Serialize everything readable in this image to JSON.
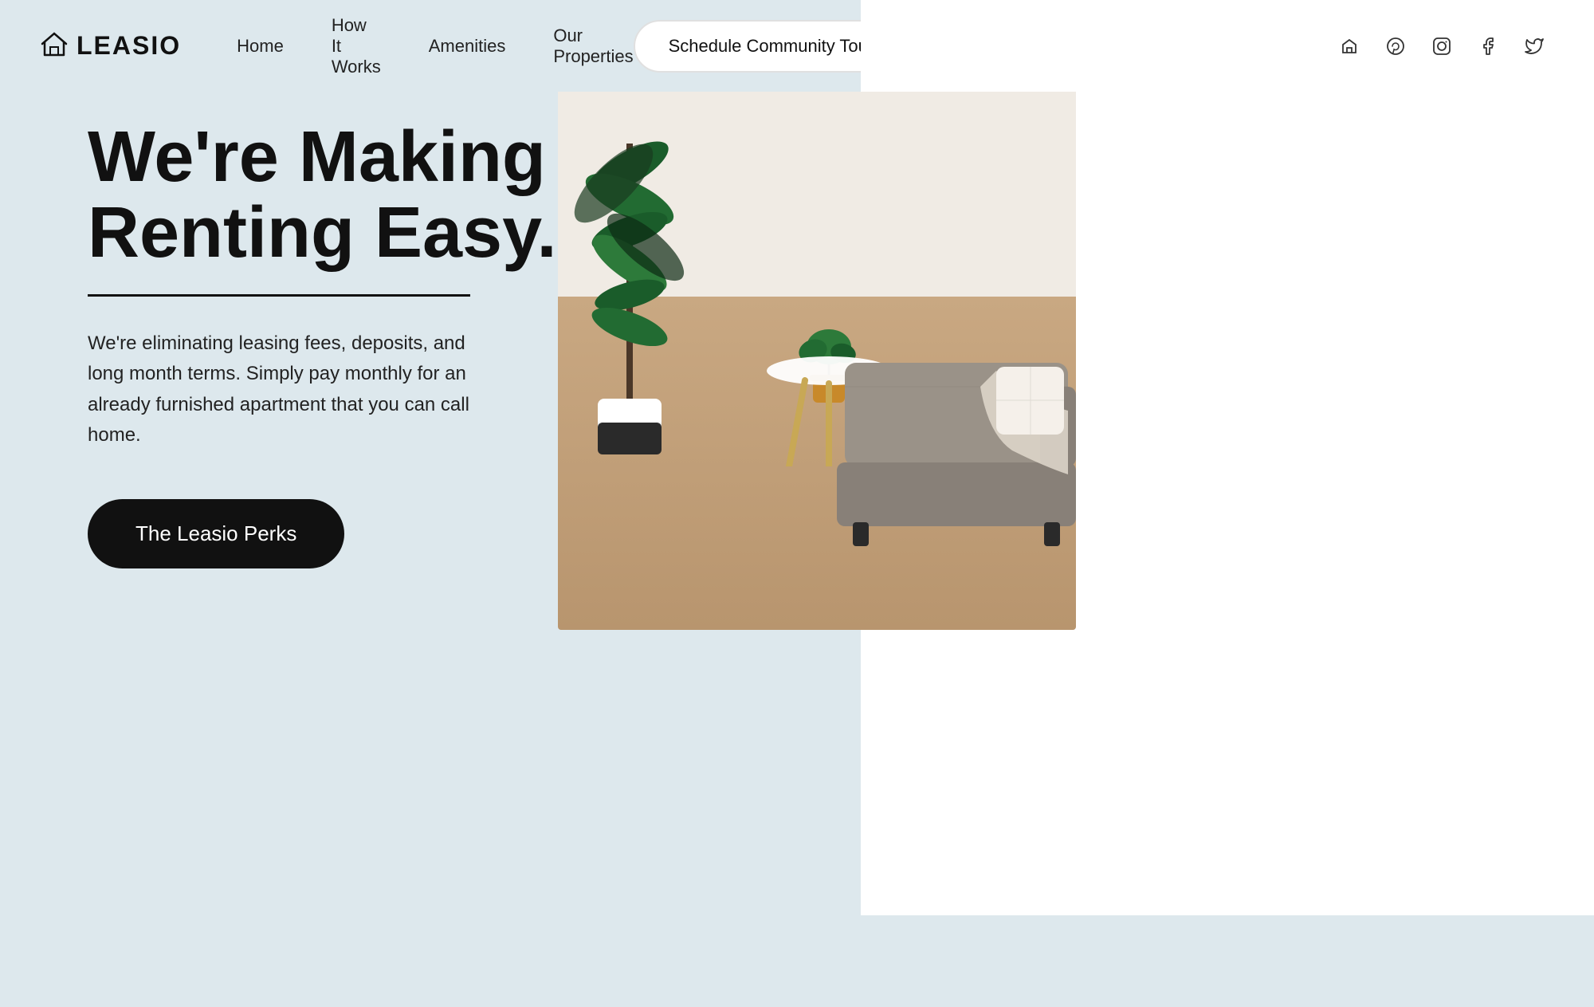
{
  "navbar": {
    "logo_text": "LEASIO",
    "nav_items": [
      {
        "label": "Home",
        "href": "#"
      },
      {
        "label": "How It Works",
        "href": "#"
      },
      {
        "label": "Amenities",
        "href": "#"
      },
      {
        "label": "Our Properties",
        "href": "#"
      }
    ],
    "cta_label": "Schedule Community Tour",
    "social_icons": [
      {
        "name": "houzz-icon",
        "symbol": "⌂"
      },
      {
        "name": "pinterest-icon",
        "symbol": "𝓟"
      },
      {
        "name": "instagram-icon",
        "symbol": "◻"
      },
      {
        "name": "facebook-icon",
        "symbol": "f"
      },
      {
        "name": "twitter-icon",
        "symbol": "🐦"
      }
    ]
  },
  "hero": {
    "title_line1": "We're Making",
    "title_line2": "Renting Easy.",
    "description": "We're eliminating leasing fees, deposits, and long month terms. Simply pay monthly for an already furnished apartment that you can call home.",
    "cta_label": "The Leasio Perks"
  }
}
